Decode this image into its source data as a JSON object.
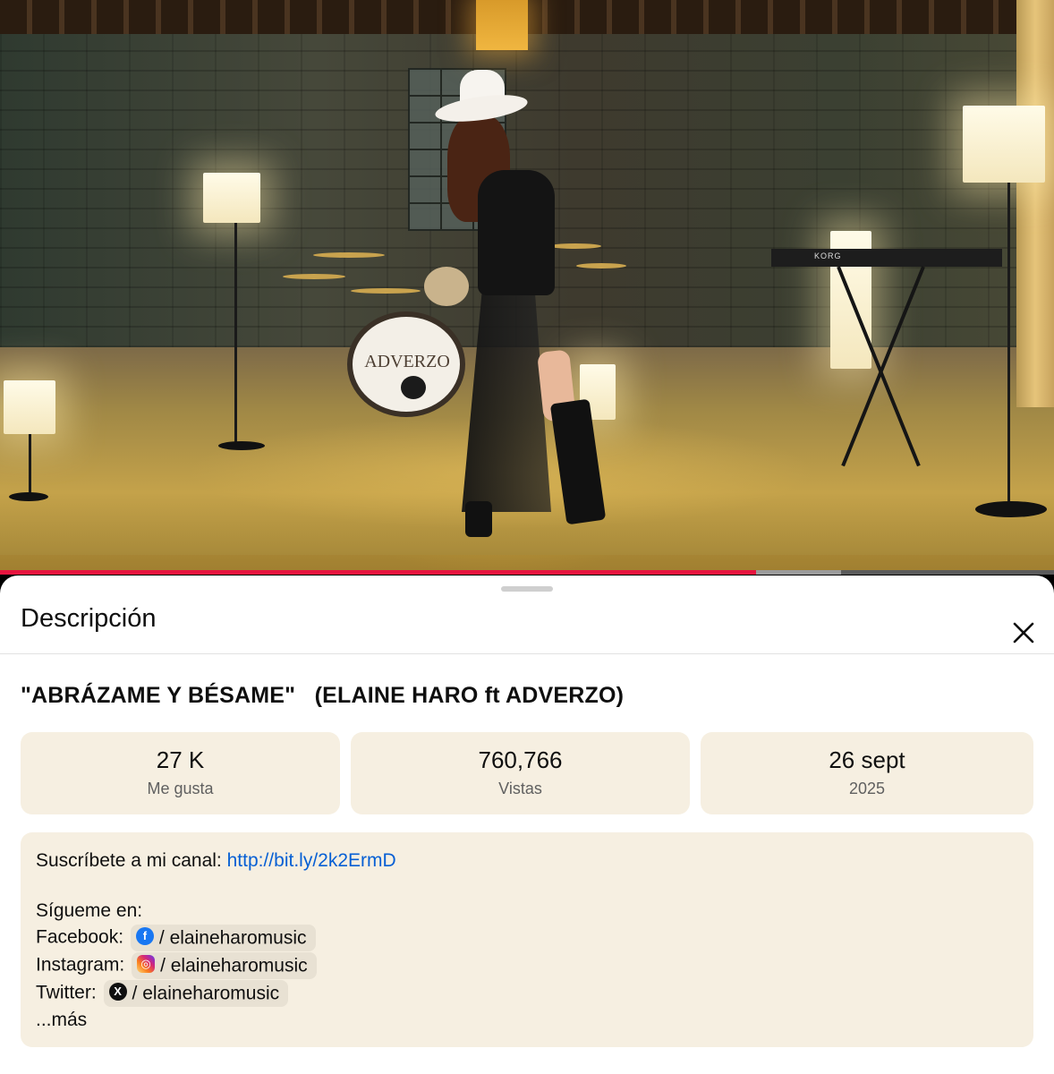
{
  "video": {
    "drum_brand": "ADVERZO",
    "keyboard_brand": "KORG",
    "progress": {
      "played_fraction": 0.717,
      "buffered_fraction": 0.798
    }
  },
  "sheet": {
    "title": "Descripción",
    "close_icon": "close-icon"
  },
  "video_title": "\"ABRÁZAME Y BÉSAME\"   (ELAINE HARO ft ADVERZO)",
  "stats": [
    {
      "value": "27 K",
      "label": "Me gusta"
    },
    {
      "value": "760,766",
      "label": "Vistas"
    },
    {
      "value": "26 sept",
      "label": "2025"
    }
  ],
  "description": {
    "subscribe_prefix": "Suscríbete a mi canal: ",
    "subscribe_link": "http://bit.ly/2k2ErmD",
    "follow_heading": "Sígueme en:",
    "socials": [
      {
        "label": "Facebook:",
        "icon": "facebook-icon",
        "handle": "/ elaineharomusic"
      },
      {
        "label": "Instagram:",
        "icon": "instagram-icon",
        "handle": "/ elaineharomusic"
      },
      {
        "label": "Twitter:",
        "icon": "x-icon",
        "handle": "/ elaineharomusic"
      }
    ],
    "more_label": "...más"
  },
  "colors": {
    "progress_played": "#e6143f",
    "link": "#065fd4",
    "card_background": "#f6efe1"
  }
}
